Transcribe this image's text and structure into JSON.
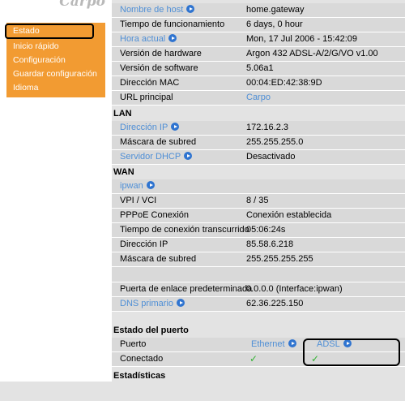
{
  "logo": {
    "text": "Carpo"
  },
  "sidebar": {
    "items": [
      {
        "label": "Estado",
        "active": true
      },
      {
        "label": "Inicio rápido"
      },
      {
        "label": "Configuración"
      },
      {
        "label": "Guardar configuración"
      },
      {
        "label": "Idioma"
      }
    ]
  },
  "info": {
    "hostname": {
      "label": "Nombre de host",
      "value": "home.gateway"
    },
    "uptime": {
      "label": "Tiempo de funcionamiento",
      "value": "6 days, 0 hour"
    },
    "time": {
      "label": "Hora actual",
      "value": "Mon, 17 Jul 2006 - 15:42:09"
    },
    "hw": {
      "label": "Versión de hardware",
      "value": "Argon 432 ADSL-A/2/G/VO v1.00"
    },
    "sw": {
      "label": "Versión de software",
      "value": "5.06a1"
    },
    "mac": {
      "label": "Dirección MAC",
      "value": "00:04:ED:42:38:9D"
    },
    "url": {
      "label": "URL principal",
      "value": "Carpo"
    }
  },
  "lan": {
    "title": "LAN",
    "ip": {
      "label": "Dirección IP",
      "value": "172.16.2.3"
    },
    "mask": {
      "label": "Máscara de subred",
      "value": "255.255.255.0"
    },
    "dhcp": {
      "label": "Servidor DHCP",
      "value": "Desactivado"
    }
  },
  "wan": {
    "title": "WAN",
    "iface": {
      "label": "ipwan"
    },
    "vpivci": {
      "label": "VPI / VCI",
      "value": "8  /  35"
    },
    "pppoe": {
      "label": "PPPoE Conexión",
      "value": "Conexión establecida"
    },
    "conn_time": {
      "label": "Tiempo de conexión transcurrido",
      "value": "05:06:24s"
    },
    "ip": {
      "label": "Dirección IP",
      "value": "85.58.6.218"
    },
    "mask": {
      "label": "Máscara de subred",
      "value": "255.255.255.255"
    },
    "gateway": {
      "label": "Puerta de enlace predeterminada",
      "value": "0.0.0.0   (Interface:ipwan)"
    },
    "dns": {
      "label": "DNS primario",
      "value": "62.36.225.150"
    }
  },
  "port_status": {
    "title": "Estado del puerto",
    "port_label": "Puerto",
    "ethernet": "Ethernet",
    "adsl": "ADSL",
    "connected_label": "Conectado",
    "check": "✓"
  },
  "stats": {
    "title": "Estadísticas"
  }
}
